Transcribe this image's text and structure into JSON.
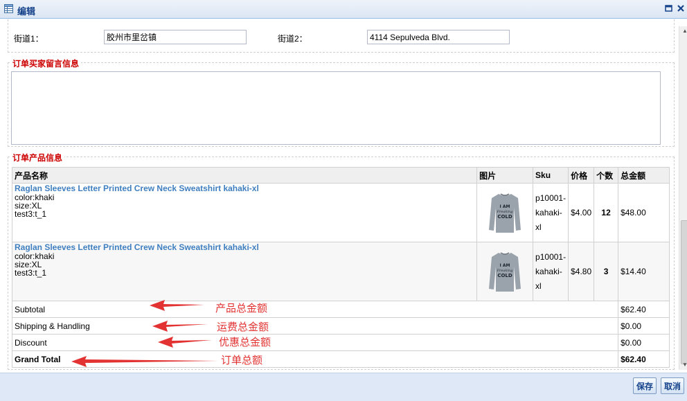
{
  "window": {
    "title": "编辑",
    "icon": "table-icon",
    "maximize_icon": "maximize-icon",
    "close_icon": "close-icon"
  },
  "address": {
    "street1_label": "街道1：",
    "street1_value": "胶州市里岔镇",
    "street2_label": "街道2：",
    "street2_value": "4114 Sepulveda Blvd."
  },
  "message_section": {
    "title": "订单买家留言信息",
    "value": ""
  },
  "products_section": {
    "title": "订单产品信息",
    "columns": [
      "产品名称",
      "图片",
      "Sku",
      "价格",
      "个数",
      "总金额"
    ],
    "rows": [
      {
        "name": "Raglan Sleeves Letter Printed Crew Neck Sweatshirt kahaki-xl",
        "attr1": "color:khaki",
        "attr2": "size:XL",
        "attr3": "test3:t_1",
        "sku1": "p10001-",
        "sku2": "kahaki-",
        "sku3": "xl",
        "price": "$4.00",
        "qty": "12",
        "total": "$48.00",
        "image_text1": "I AM",
        "image_text2": "Freaking",
        "image_text3": "COLD"
      },
      {
        "name": "Raglan Sleeves Letter Printed Crew Neck Sweatshirt kahaki-xl",
        "attr1": "color:khaki",
        "attr2": "size:XL",
        "attr3": "test3:t_1",
        "sku1": "p10001-",
        "sku2": "kahaki-",
        "sku3": "xl",
        "price": "$4.80",
        "qty": "3",
        "total": "$14.40",
        "image_text1": "I AM",
        "image_text2": "Freaking",
        "image_text3": "COLD"
      }
    ],
    "summary": [
      {
        "label": "Subtotal",
        "value": "$62.40",
        "bold": false
      },
      {
        "label": "Shipping & Handling",
        "value": "$0.00",
        "bold": false
      },
      {
        "label": "Discount",
        "value": "$0.00",
        "bold": false
      },
      {
        "label": "Grand Total",
        "value": "$62.40",
        "bold": true
      }
    ]
  },
  "annotations": [
    "产品总金额",
    "运费总金额",
    "优惠总金额",
    "订单总额"
  ],
  "buttons": {
    "save": "保存",
    "cancel": "取消"
  },
  "colors": {
    "accent": "#15428b",
    "legend": "#cc0000",
    "link": "#3f7fc0",
    "annotation": "#e23232"
  }
}
